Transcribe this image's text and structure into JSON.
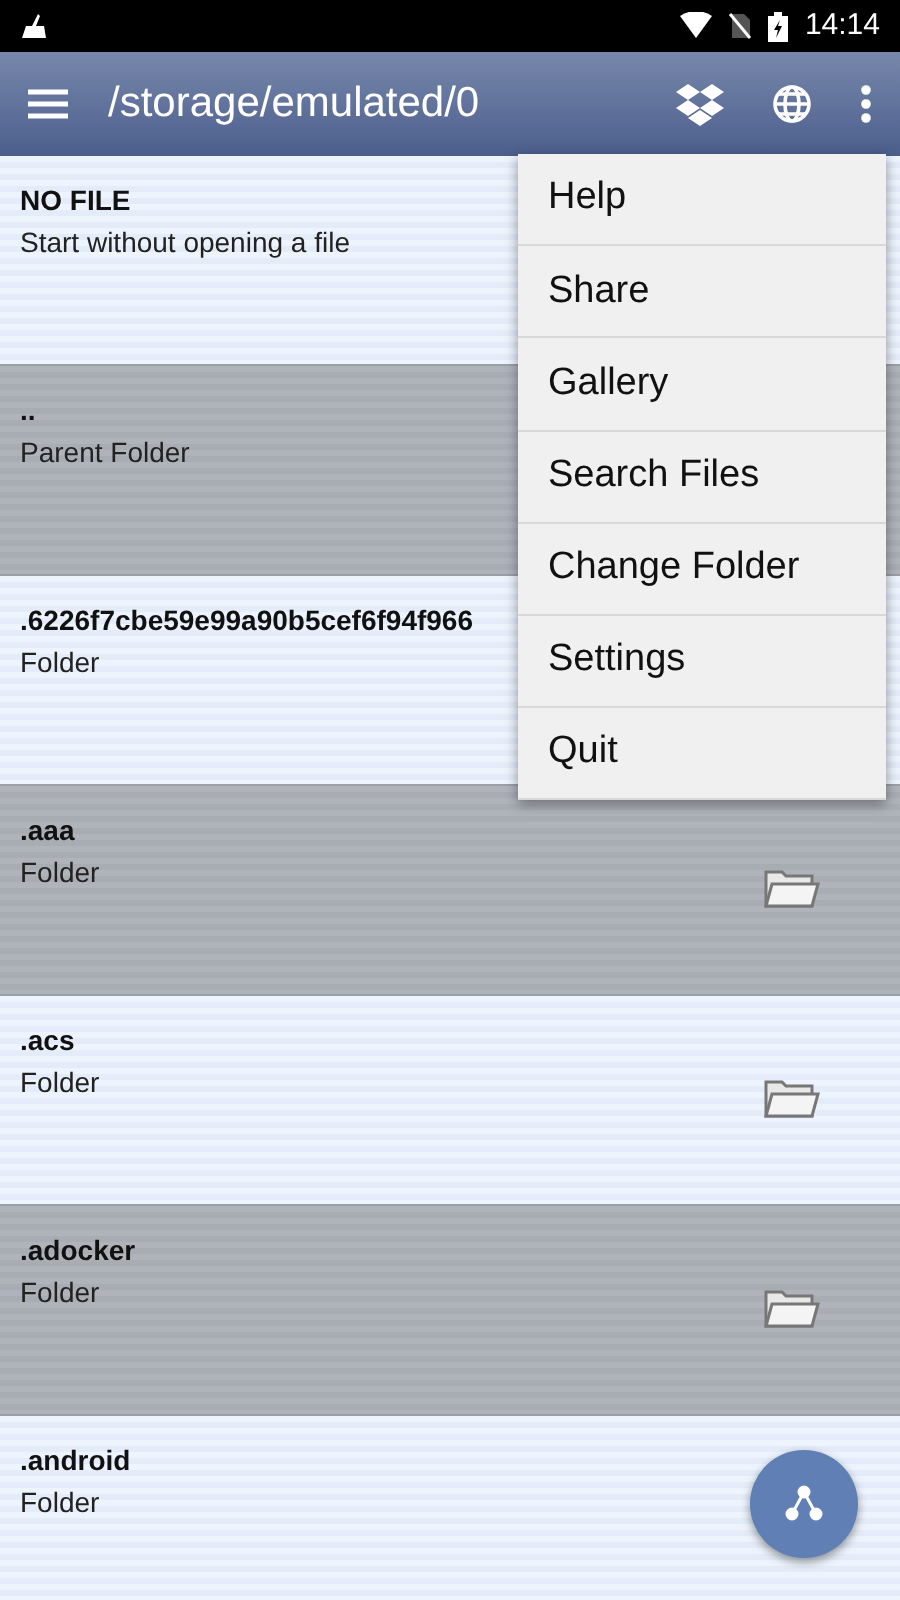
{
  "status_bar": {
    "time": "14:14"
  },
  "toolbar": {
    "title": "/storage/emulated/0"
  },
  "rows": [
    {
      "name": "NO FILE",
      "detail": "Start without opening a file",
      "kind": "plain"
    },
    {
      "name": "..",
      "detail": "Parent Folder",
      "kind": "plain"
    },
    {
      "name": ".6226f7cbe59e99a90b5cef6f94f966",
      "detail": "Folder",
      "kind": "plain"
    },
    {
      "name": ".aaa",
      "detail": "Folder",
      "kind": "folder"
    },
    {
      "name": ".acs",
      "detail": "Folder",
      "kind": "folder"
    },
    {
      "name": ".adocker",
      "detail": "Folder",
      "kind": "folder"
    },
    {
      "name": ".android",
      "detail": "Folder",
      "kind": "plain"
    }
  ],
  "menu": [
    "Help",
    "Share",
    "Gallery",
    "Search Files",
    "Change Folder",
    "Settings",
    "Quit"
  ]
}
